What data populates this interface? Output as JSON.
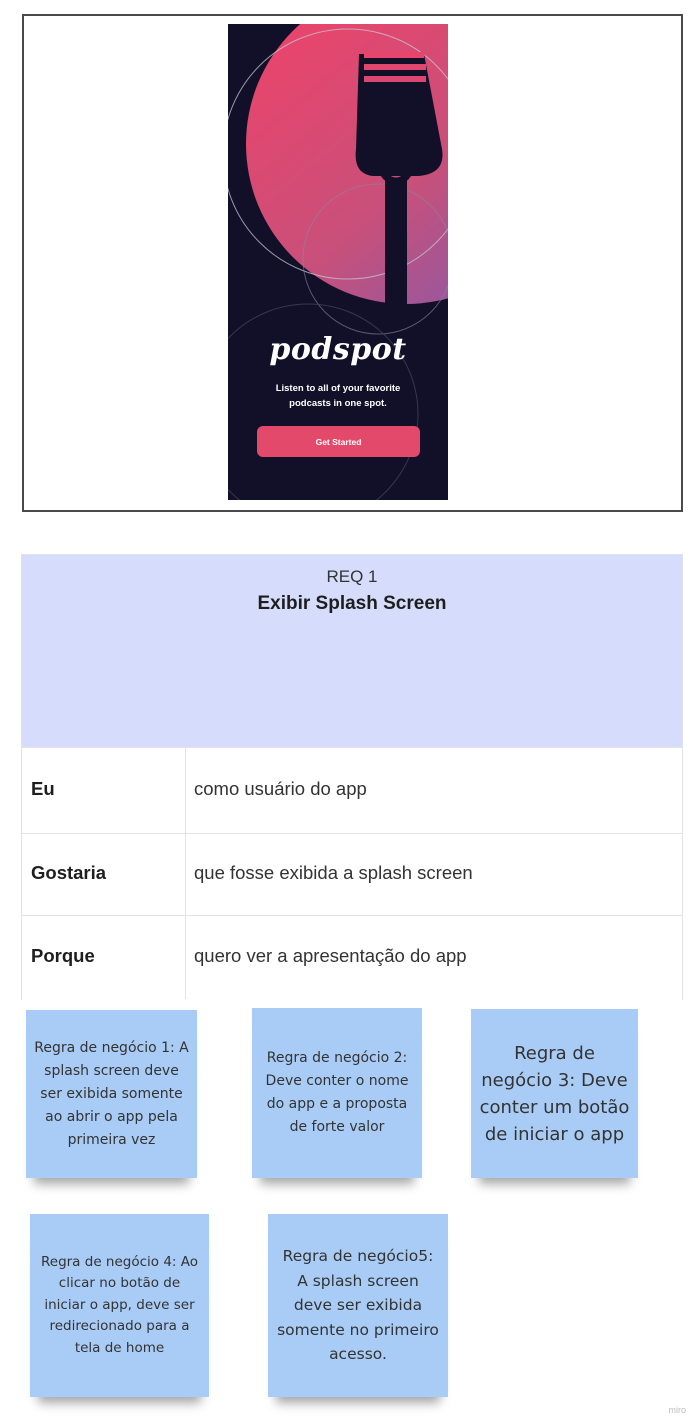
{
  "app_preview": {
    "brand": "podspot",
    "tagline": "Listen to all of your favorite podcasts in one spot.",
    "cta_label": "Get Started",
    "colors": {
      "background": "#121028",
      "accent": "#e2496a",
      "gradient_end": "#8a5aa8"
    }
  },
  "requirement": {
    "number": "REQ 1",
    "title": "Exibir Splash Screen",
    "rows": [
      {
        "key": "Eu",
        "value": "como usuário do app"
      },
      {
        "key": "Gostaria",
        "value": "que  fosse  exibida a splash screen"
      },
      {
        "key": "Porque",
        "value": "quero ver a apresentação do app"
      }
    ]
  },
  "notes": [
    "Regra de negócio 1: A splash screen deve ser exibida somente ao abrir o app pela primeira vez",
    "Regra de negócio 2: Deve conter o nome do app  e a proposta de forte valor",
    "Regra de negócio 3: Deve conter um botão de iniciar o app",
    "Regra de negócio 4: Ao clicar no botão de iniciar o app, deve ser redirecionado para a tela de home",
    "Regra de negócio5: A splash screen deve ser exibida somente no primeiro acesso."
  ],
  "watermark": "miro"
}
